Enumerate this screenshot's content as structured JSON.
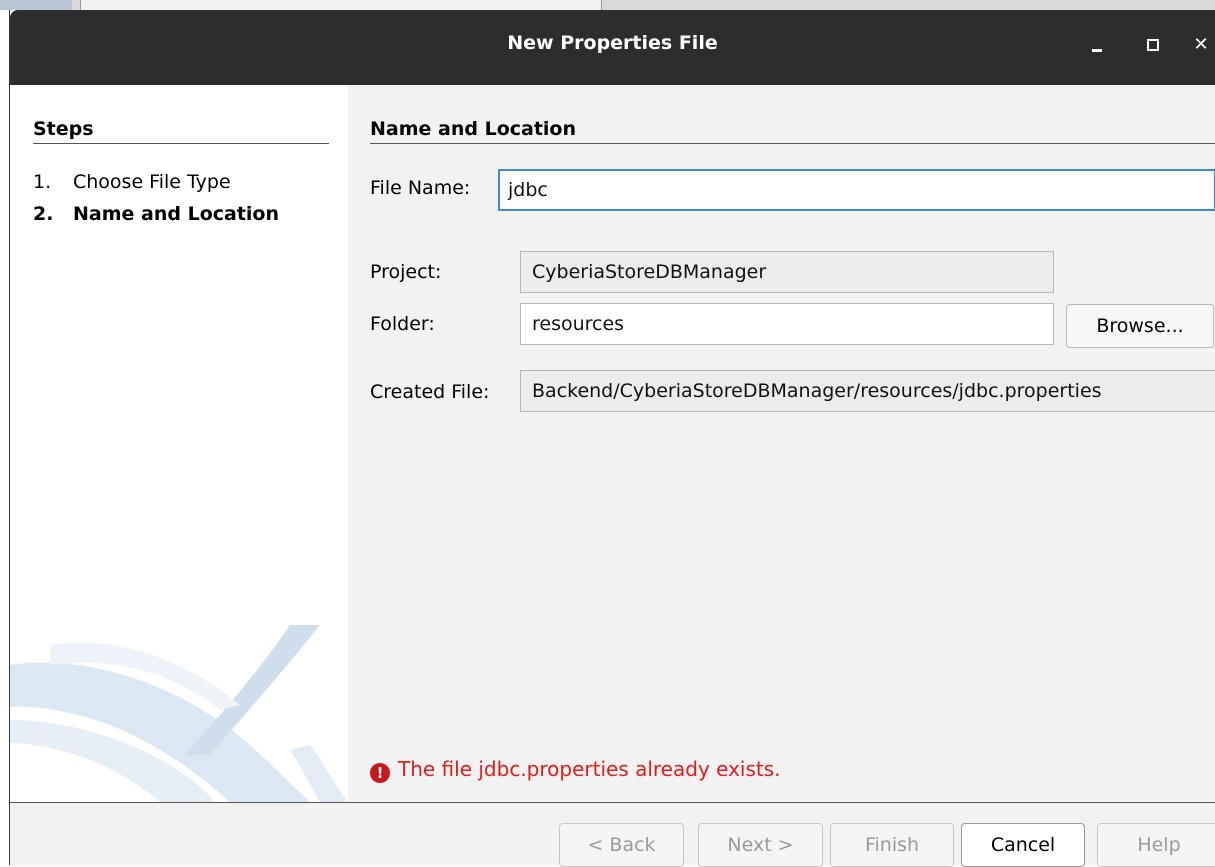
{
  "window": {
    "title": "New Properties File"
  },
  "steps": {
    "title": "Steps",
    "items": [
      {
        "num": "1.",
        "label": "Choose File Type"
      },
      {
        "num": "2.",
        "label": "Name and Location"
      }
    ]
  },
  "form": {
    "section_title": "Name and Location",
    "file_name_label": "File Name:",
    "file_name_value": "jdbc",
    "project_label": "Project:",
    "project_value": "CyberiaStoreDBManager",
    "folder_label": "Folder:",
    "folder_value": "resources",
    "browse_label": "Browse...",
    "created_file_label": "Created File:",
    "created_file_value": "Backend/CyberiaStoreDBManager/resources/jdbc.properties"
  },
  "error": {
    "icon": "!",
    "message": "The file jdbc.properties already exists."
  },
  "buttons": {
    "back": "< Back",
    "next": "Next >",
    "finish": "Finish",
    "cancel": "Cancel",
    "help": "Help"
  },
  "colors": {
    "error": "#e21b1b",
    "focus": "#3d8bd6",
    "titlebar": "#2d2d2d"
  }
}
